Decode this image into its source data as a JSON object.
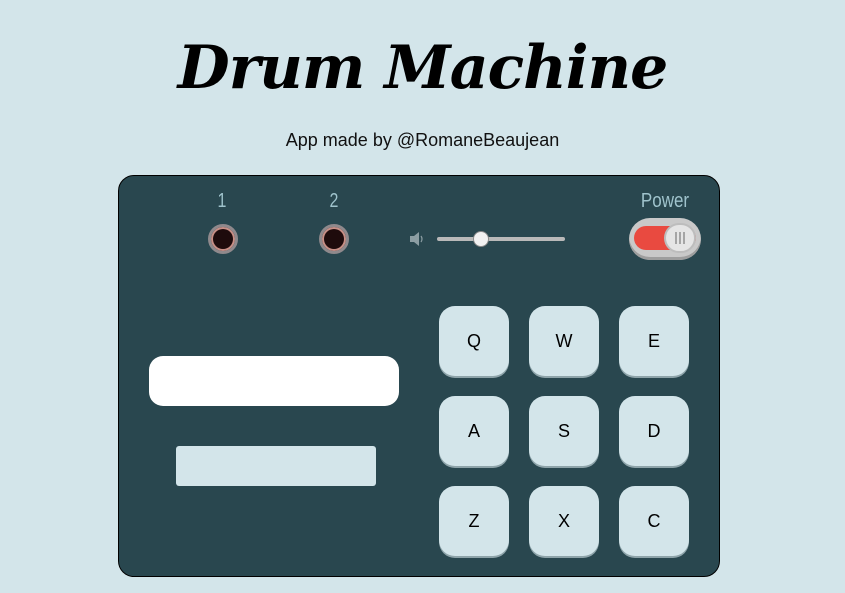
{
  "header": {
    "title": "Drum Machine",
    "credit": "App made by @RomaneBeaujean"
  },
  "controls": {
    "banks": [
      {
        "label": "1"
      },
      {
        "label": "2"
      }
    ],
    "volume": {
      "icon": "speaker-icon",
      "level": 0.32
    },
    "power": {
      "label": "Power",
      "state": "on",
      "accent": "#e94a40"
    }
  },
  "display": {
    "text": "",
    "bank_text": ""
  },
  "pads": [
    {
      "key": "Q"
    },
    {
      "key": "W"
    },
    {
      "key": "E"
    },
    {
      "key": "A"
    },
    {
      "key": "S"
    },
    {
      "key": "D"
    },
    {
      "key": "Z"
    },
    {
      "key": "X"
    },
    {
      "key": "C"
    }
  ],
  "colors": {
    "background": "#d3e5ea",
    "machine": "#29474f",
    "pad": "#d3e5ea",
    "label": "#9fc3cc"
  }
}
